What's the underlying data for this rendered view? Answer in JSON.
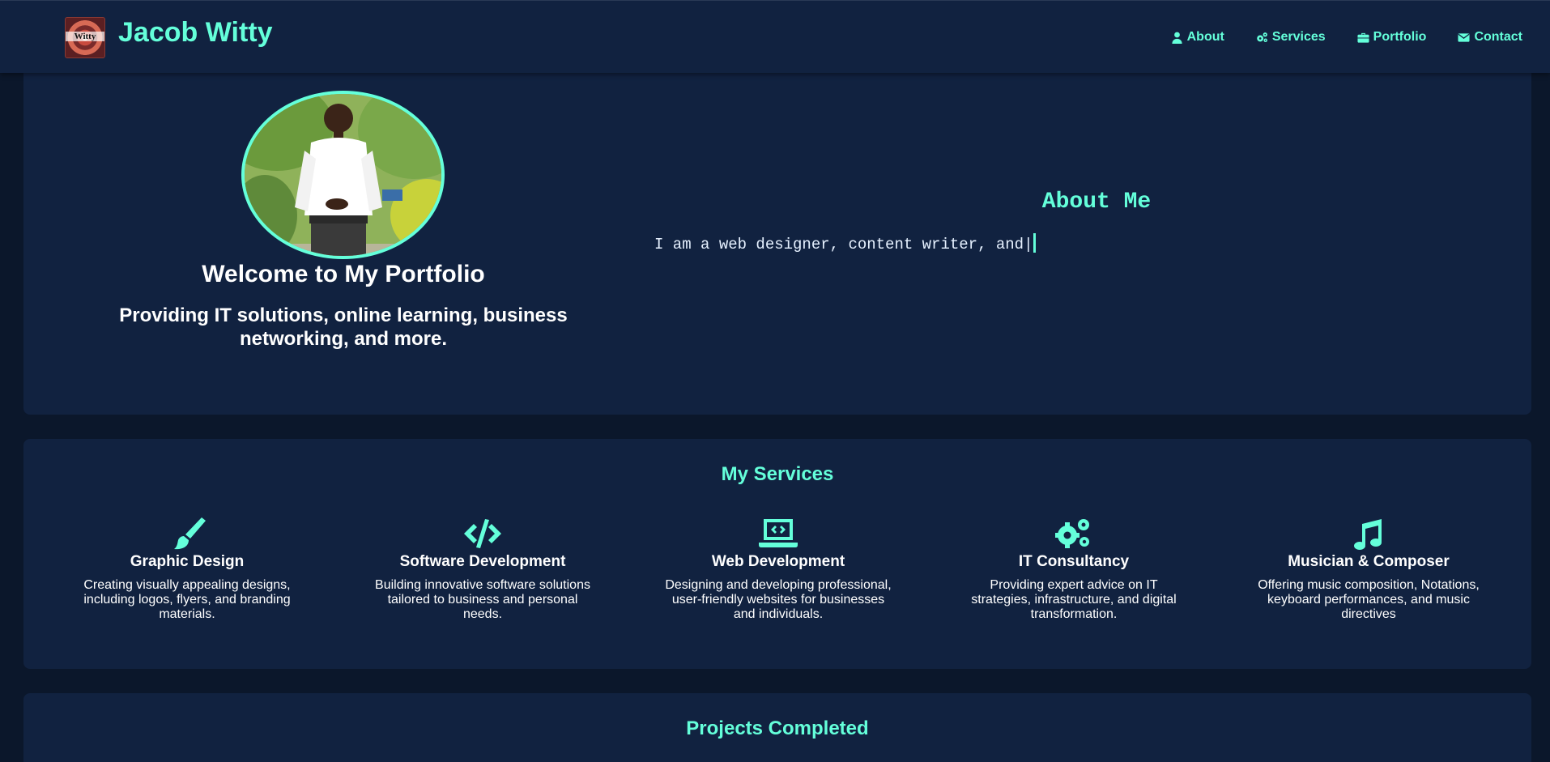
{
  "header": {
    "brand": "Jacob Witty",
    "logo_text": "Witty",
    "nav": [
      {
        "label": "About",
        "icon": "user-icon"
      },
      {
        "label": "Services",
        "icon": "gears-icon"
      },
      {
        "label": "Portfolio",
        "icon": "briefcase-icon"
      },
      {
        "label": "Contact",
        "icon": "envelope-icon"
      }
    ]
  },
  "hero": {
    "title": "Welcome to My Portfolio",
    "subtitle": "Providing IT solutions, online learning, business networking, and more.",
    "about_title": "About Me",
    "about_text": "I am a web designer, content writer, and|"
  },
  "services": {
    "title": "My Services",
    "items": [
      {
        "icon": "paintbrush-icon",
        "title": "Graphic Design",
        "desc": "Creating visually appealing designs, including logos, flyers, and branding materials."
      },
      {
        "icon": "code-icon",
        "title": "Software Development",
        "desc": "Building innovative software solutions tailored to business and personal needs."
      },
      {
        "icon": "laptop-code-icon",
        "title": "Web Development",
        "desc": "Designing and developing professional, user-friendly websites for businesses and individuals."
      },
      {
        "icon": "gears-icon",
        "title": "IT Consultancy",
        "desc": "Providing expert advice on IT strategies, infrastructure, and digital transformation."
      },
      {
        "icon": "music-icon",
        "title": "Musician & Composer",
        "desc": "Offering music composition, Notations, keyboard performances, and music directives"
      }
    ]
  },
  "projects": {
    "title": "Projects Completed"
  },
  "colors": {
    "accent": "#64ffda",
    "panel": "#112240",
    "background": "#0b172b"
  }
}
